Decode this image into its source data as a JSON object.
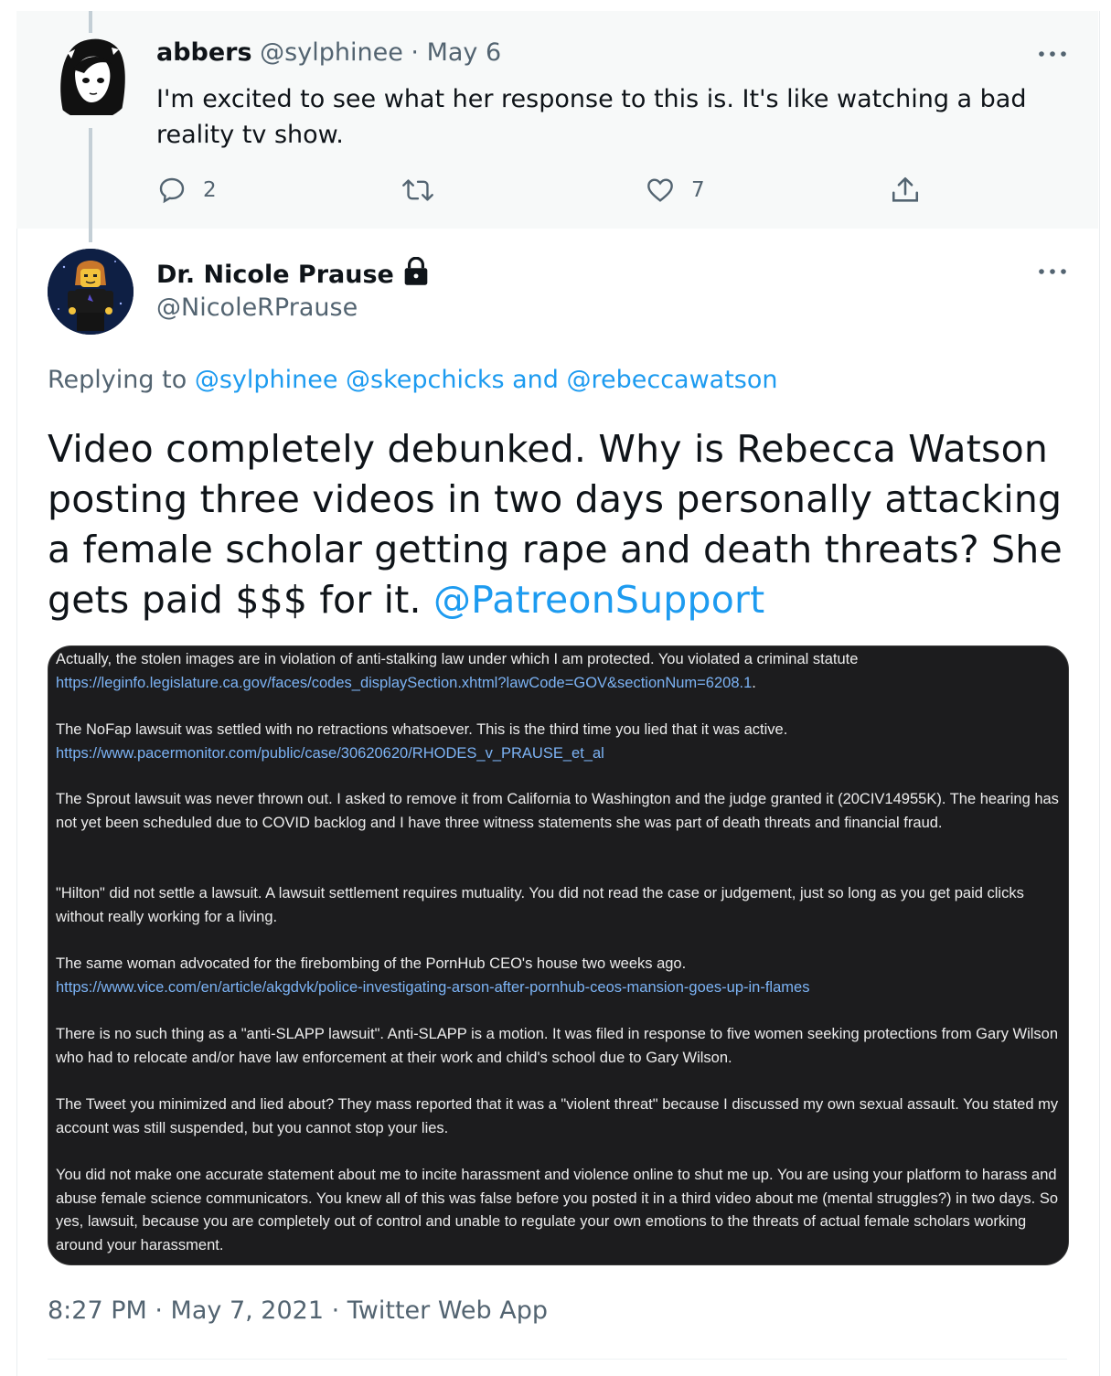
{
  "prev_tweet": {
    "display_name": "abbers",
    "handle": "@sylphinee",
    "separator": "·",
    "date": "May 6",
    "text": "I'm excited to see what her response to this is. It's like watching a bad reality tv show.",
    "actions": {
      "reply_count": "2",
      "retweet_count": "",
      "like_count": "7"
    }
  },
  "main_tweet": {
    "display_name": "Dr. Nicole Prause",
    "handle": "@NicoleRPrause",
    "replying_prefix": "Replying to",
    "replying_mentions": "@sylphinee @skepchicks and @rebeccawatson",
    "text": "Video completely debunked. Why is Rebecca Watson posting three videos in two days personally attacking a female scholar getting rape and death threats? She gets paid $$$ for it.",
    "text_mention": "@PatreonSupport",
    "timestamp": "8:27 PM · May 7, 2021 · Twitter Web App"
  },
  "embedded_image": {
    "paragraphs": [
      {
        "text": "Actually, the stolen images are in violation of anti-stalking law under which I am protected. You violated a criminal statute",
        "link": "https://leginfo.legislature.ca.gov/faces/codes_displaySection.xhtml?lawCode=GOV&sectionNum=6208.1",
        "link_suffix": "."
      },
      {
        "text": "The NoFap lawsuit was settled with no retractions whatsoever. This is the third time you lied that it was active.",
        "link": "https://www.pacermonitor.com/public/case/30620620/RHODES_v_PRAUSE_et_al",
        "link_suffix": ""
      },
      {
        "text": "The Sprout lawsuit was never thrown out. I asked to remove it from California to Washington and the judge granted it (20CIV14955K). The hearing has not yet been scheduled due to COVID backlog and I have three witness statements she was part of death threats and financial fraud.",
        "link": "",
        "link_suffix": ""
      },
      {
        "text": "\"Hilton\" did not settle a lawsuit.  A lawsuit settlement requires mutuality. You did not read the case or judgement, just so long as you get paid clicks without really working for a living.",
        "link": "",
        "link_suffix": ""
      },
      {
        "text": "The same woman advocated for the firebombing of the PornHub CEO's house two weeks ago.",
        "link": "https://www.vice.com/en/article/akgdvk/police-investigating-arson-after-pornhub-ceos-mansion-goes-up-in-flames",
        "link_suffix": ""
      },
      {
        "text": "There is no such thing as a \"anti-SLAPP lawsuit\". Anti-SLAPP is a motion. It was filed in response to five women seeking protections from Gary Wilson who had to relocate and/or have law enforcement at their work and child's school due to Gary Wilson.",
        "link": "",
        "link_suffix": ""
      },
      {
        "text": "The Tweet you minimized and lied about? They mass reported that it was a \"violent threat\" because I discussed my own sexual assault. You stated my account was still suspended, but you cannot stop your lies.",
        "link": "",
        "link_suffix": ""
      },
      {
        "text": "You did not make one accurate statement about me to incite harassment and violence online to shut me up. You are using your platform to harass and abuse female science communicators. You knew all of this was false before you posted it in a third video about me (mental struggles?) in two days.  So yes, lawsuit, because you are completely out of control and unable to regulate your own emotions to the threats of actual female scholars working around your harassment.",
        "link": "",
        "link_suffix": ""
      }
    ]
  },
  "icons": {
    "more": "more-horizontal-icon",
    "reply": "reply-bubble-icon",
    "retweet": "retweet-icon",
    "like": "heart-icon",
    "share": "share-icon",
    "protected": "lock-icon"
  },
  "colors": {
    "link_blue": "#1d9bf0",
    "secondary_text": "#536471",
    "prev_tweet_bg": "#f7f9f9",
    "embedded_bg": "#1c1c1e"
  }
}
